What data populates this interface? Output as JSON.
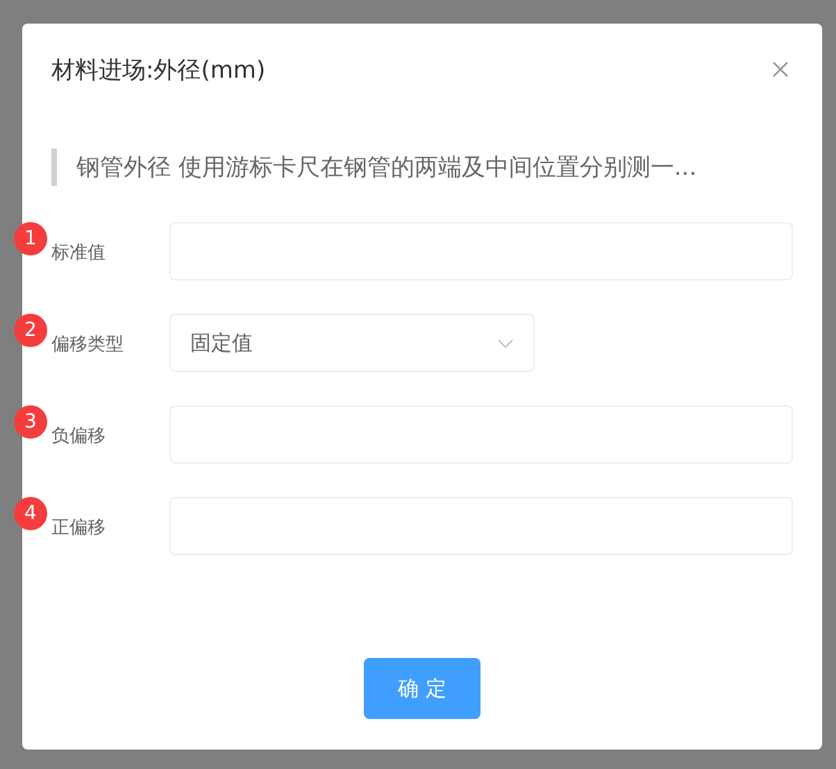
{
  "dialog": {
    "title": "材料进场:外径(mm)",
    "description": "钢管外径 使用游标卡尺在钢管的两端及中间位置分别测一...",
    "fields": [
      {
        "badge": "1",
        "label": "标准值",
        "kind": "input"
      },
      {
        "badge": "2",
        "label": "偏移类型",
        "kind": "select",
        "value": "固定值"
      },
      {
        "badge": "3",
        "label": "负偏移",
        "kind": "input"
      },
      {
        "badge": "4",
        "label": "正偏移",
        "kind": "input"
      }
    ],
    "confirm_button": "确 定"
  }
}
